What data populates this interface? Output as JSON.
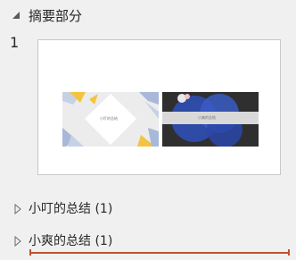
{
  "section": {
    "title": "摘要部分",
    "toggle_icon": "triangle-expanded-icon"
  },
  "slide": {
    "number": "1",
    "mini_slides": [
      {
        "label": "小叮的总结",
        "theme": "light-geometric"
      },
      {
        "label": "小爽的总结",
        "theme": "dark-blue-circles"
      }
    ]
  },
  "groups": [
    {
      "label": "小叮的总结 (1)",
      "icon": "chevron-right-icon"
    },
    {
      "label": "小爽的总结 (1)",
      "icon": "chevron-right-icon"
    }
  ],
  "colors": {
    "background": "#f0f0f0",
    "accent_drop_line": "#c1502e",
    "mini_left_shapes": [
      "#f3c443",
      "#a8b8d8",
      "#c7d1e6"
    ],
    "mini_right_circles": "#2f4fb4"
  }
}
